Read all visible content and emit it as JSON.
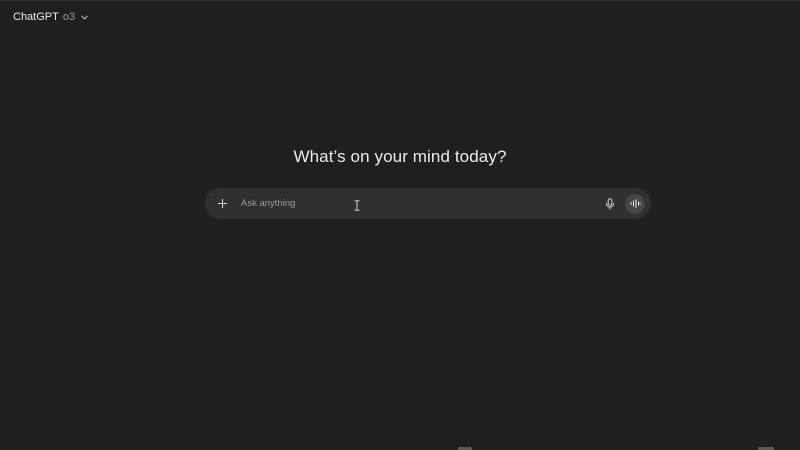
{
  "header": {
    "model_name": "ChatGPT",
    "model_version": "o3",
    "chevron_icon": "chevron-down-icon"
  },
  "main": {
    "headline": "What’s on your mind today?"
  },
  "composer": {
    "placeholder": "Ask anything",
    "value": "",
    "icons": {
      "add": "plus-icon",
      "dictate": "microphone-icon",
      "voice": "voice-mode-icon"
    }
  },
  "colors": {
    "background": "#1f1f1f",
    "composer": "#303030",
    "text": "#ececec",
    "muted": "#9a9a9a",
    "voice_button": "#474747"
  }
}
